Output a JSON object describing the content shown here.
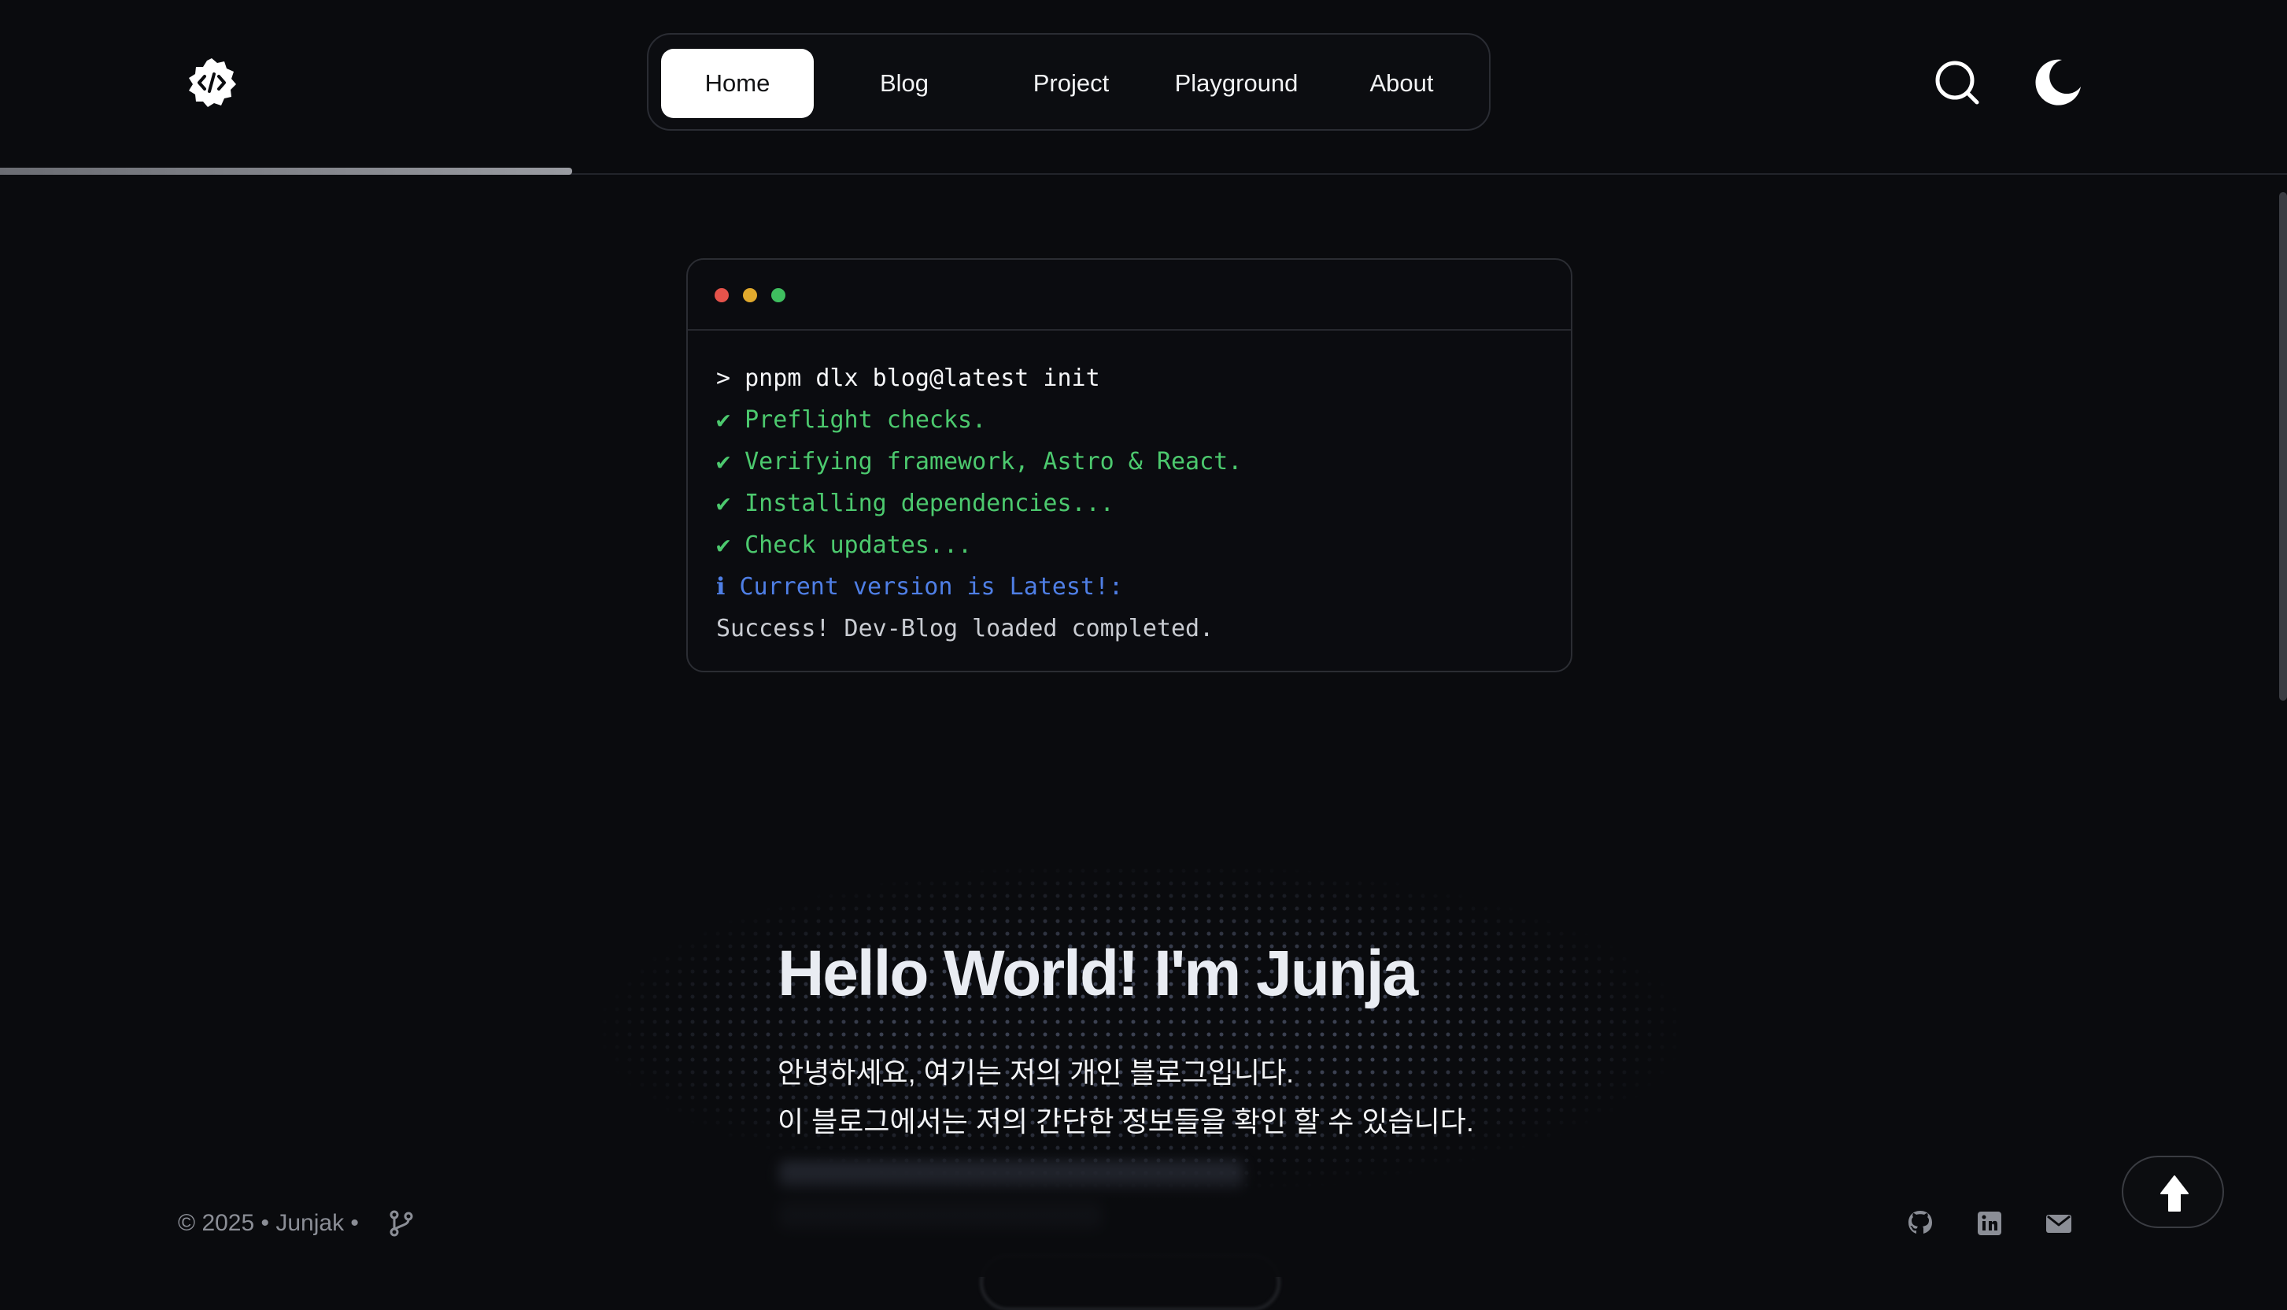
{
  "colors": {
    "background": "#0a0b0e",
    "accent_green": "#4cc96e",
    "accent_blue": "#4f7fe6",
    "dot_red": "#e5534b",
    "dot_yellow": "#e0a92d",
    "dot_green": "#3fbf5f"
  },
  "header": {
    "logo_icon": "code-badge-icon",
    "nav": [
      {
        "label": "Home",
        "active": true
      },
      {
        "label": "Blog",
        "active": false
      },
      {
        "label": "Project",
        "active": false
      },
      {
        "label": "Playground",
        "active": false
      },
      {
        "label": "About",
        "active": false
      }
    ],
    "search_icon": "search-icon",
    "theme_icon": "moon-icon"
  },
  "reading_progress": 0.25,
  "terminal": {
    "lines": [
      {
        "text": "> pnpm dlx blog@latest init",
        "kind": "cmd"
      },
      {
        "text": "✔ Preflight checks.",
        "kind": "ok"
      },
      {
        "text": "✔ Verifying framework, Astro & React.",
        "kind": "ok"
      },
      {
        "text": "✔ Installing dependencies...",
        "kind": "ok"
      },
      {
        "text": "✔ Check updates...",
        "kind": "ok"
      },
      {
        "text": "ℹ Current version is Latest!:",
        "kind": "info"
      },
      {
        "text": "Success! Dev-Blog loaded completed.",
        "kind": "success"
      }
    ]
  },
  "hero": {
    "title": "Hello World! I'm Junja",
    "line1": "안녕하세요, 여기는 저의 개인 블로그입니다.",
    "line2": "이 블로그에서는 저의 간단한 정보들을 확인 할 수 있습니다."
  },
  "footer": {
    "copyright": "© 2025 • Junjak •",
    "branch_icon": "git-branch-icon",
    "social_icons": [
      "github-icon",
      "linkedin-icon",
      "mail-icon"
    ]
  },
  "scroll_top_icon": "arrow-up-icon"
}
